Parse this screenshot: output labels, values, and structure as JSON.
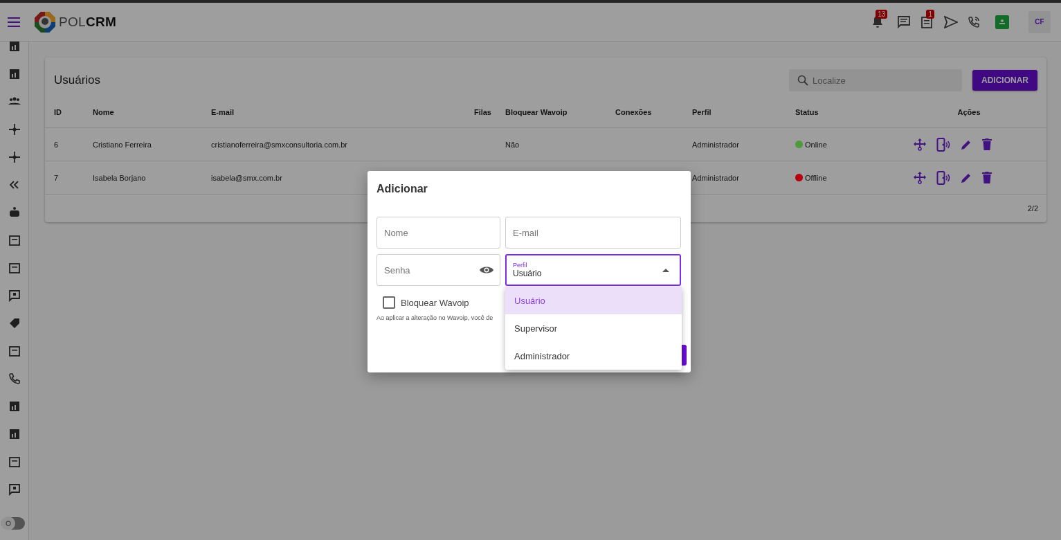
{
  "topbar": {
    "logo_light": "POL",
    "logo_bold": "CRM",
    "notifications_badge": "13",
    "tasks_badge": "1",
    "avatar": "CF"
  },
  "page": {
    "title": "Usuários",
    "search": {
      "placeholder": "Localize"
    },
    "add_button": "ADICIONAR"
  },
  "table": {
    "columns": [
      "ID",
      "Nome",
      "E-mail",
      "Filas",
      "Bloquear Wavoip",
      "Conexões",
      "Perfil",
      "Status",
      "Ações"
    ],
    "rows": [
      {
        "id": "6",
        "name": "Cristiano Ferreira",
        "email": "cristianoferreira@smxconsultoria.com.br",
        "block_wavoip": "Não",
        "profile": "Administrador",
        "status": "Online",
        "color": "#4e9a3c"
      },
      {
        "id": "7",
        "name": "Isabela Borjano",
        "email": "isabela@smx.com.br",
        "profile": "Administrador",
        "status": "Offline",
        "color": "#b8000f"
      }
    ],
    "pagination": "2/2"
  },
  "theme_toggle": {
    "on": false
  },
  "dialog": {
    "title": "Adicionar",
    "fields": [
      {
        "placeholder": "Nome"
      },
      {
        "placeholder": "E-mail"
      }
    ],
    "password": {
      "placeholder": "Senha"
    },
    "profile": {
      "label": "Perfil",
      "value": "Usuário",
      "expanded": true
    },
    "checkbox": {
      "label": "Bloquear Wavoip",
      "checked": false
    },
    "note": "Ao aplicar a alteração no Wavoip, você de",
    "options": [
      {
        "label": "Usuário",
        "selected": true
      },
      {
        "label": "Supervisor",
        "selected": false
      },
      {
        "label": "Administrador",
        "selected": false
      }
    ]
  }
}
